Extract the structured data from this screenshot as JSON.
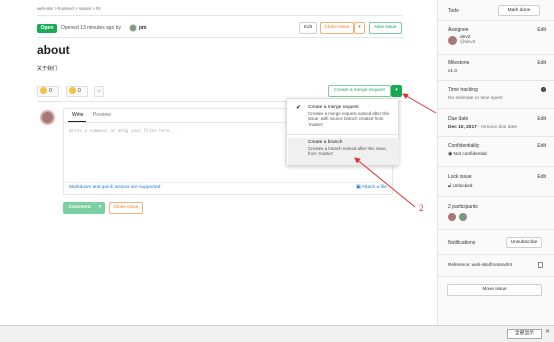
{
  "breadcrumb": "web-site > frontend > Issues > #4",
  "issue": {
    "status": "Open",
    "opened_text": "Opened 13 minutes ago by",
    "author": "pm",
    "title": "about",
    "description": "关于我们"
  },
  "header_buttons": {
    "edit": "Edit",
    "close_issue": "Close issue",
    "new_issue": "New issue"
  },
  "awards": {
    "thumbs_up_count": "0",
    "thumbs_down_count": "0"
  },
  "merge_request_button": "Create a merge request",
  "editor": {
    "tab_write": "Write",
    "tab_preview": "Preview",
    "placeholder": "Write a comment or drag your files here...",
    "markdown_note": "Markdown and quick actions are supported",
    "attach_label": "Attach a file"
  },
  "actions": {
    "comment": "Comment",
    "close_issue": "Close issue"
  },
  "dropdown": {
    "item1_title": "Create a merge request",
    "item1_desc": "Creates a merge request named after this issue, with source branch created from 'master'.",
    "item2_title": "Create a branch",
    "item2_desc": "Creates a branch named after this issue, from 'master'."
  },
  "annotations": {
    "n1": "1",
    "n2": "2"
  },
  "sidebar": {
    "todo_label": "Todo",
    "mark_done": "Mark done",
    "assignee_label": "Assignee",
    "assignee_name": "dev2",
    "assignee_handle": "@dev2",
    "milestone_label": "Milestone",
    "milestone_value": "v1.0",
    "time_tracking_label": "Time tracking",
    "time_tracking_value": "No estimate or time spent",
    "due_date_label": "Due date",
    "due_date_value": "Dec 10, 2017",
    "due_date_remove": "- remove due date",
    "confidentiality_label": "Confidentiality",
    "confidentiality_value": "Not confidential",
    "lock_label": "Lock issue",
    "lock_value": "Unlocked",
    "participants_label": "2 participants",
    "notifications_label": "Notifications",
    "unsubscribe": "Unsubscribe",
    "reference": "Reference: web-site/frontend#4",
    "move_issue": "Move issue",
    "edit_label": "Edit"
  },
  "bottom_bar": {
    "button": "全部显示"
  },
  "colors": {
    "green": "#1aaa55",
    "orange": "#e67e22",
    "blue": "#1f78d1",
    "annotation_red": "#dd3333"
  },
  "icons": [
    "thumbs-up-icon",
    "thumbs-down-icon",
    "smiley-icon",
    "caret-down-icon",
    "check-icon",
    "attach-icon",
    "help-icon",
    "eye-icon",
    "lock-icon",
    "copy-icon",
    "close-icon"
  ]
}
